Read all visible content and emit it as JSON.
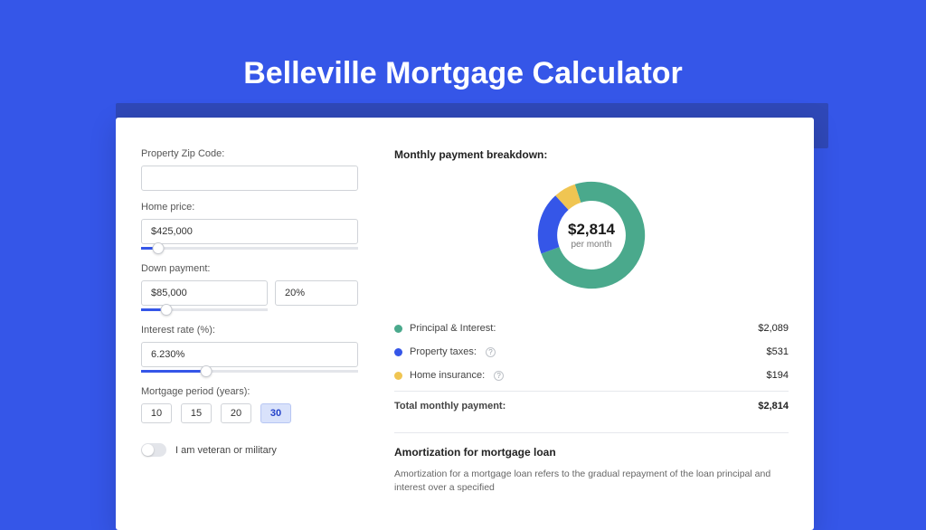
{
  "title": "Belleville Mortgage Calculator",
  "colors": {
    "principal": "#4aa98c",
    "taxes": "#3556e8",
    "insurance": "#f0c552"
  },
  "form": {
    "zip_label": "Property Zip Code:",
    "zip_value": "",
    "home_price_label": "Home price:",
    "home_price_value": "$425,000",
    "home_price_slider_pct": 8,
    "down_payment_label": "Down payment:",
    "down_payment_value": "$85,000",
    "down_payment_pct_value": "20%",
    "down_payment_slider_pct": 20,
    "interest_rate_label": "Interest rate (%):",
    "interest_rate_value": "6.230%",
    "interest_rate_slider_pct": 30,
    "period_label": "Mortgage period (years):",
    "periods": [
      "10",
      "15",
      "20",
      "30"
    ],
    "period_selected": "30",
    "veteran_label": "I am veteran or military",
    "veteran_on": false
  },
  "breakdown": {
    "title": "Monthly payment breakdown:",
    "donut_amount": "$2,814",
    "donut_sub": "per month",
    "items": [
      {
        "label": "Principal & Interest:",
        "value": "$2,089",
        "color": "#4aa98c",
        "info": false
      },
      {
        "label": "Property taxes:",
        "value": "$531",
        "color": "#3556e8",
        "info": true
      },
      {
        "label": "Home insurance:",
        "value": "$194",
        "color": "#f0c552",
        "info": true
      }
    ],
    "total_label": "Total monthly payment:",
    "total_value": "$2,814"
  },
  "chart_data": {
    "type": "pie",
    "title": "Monthly payment breakdown",
    "series": [
      {
        "name": "Principal & Interest",
        "value": 2089,
        "color": "#4aa98c"
      },
      {
        "name": "Property taxes",
        "value": 531,
        "color": "#3556e8"
      },
      {
        "name": "Home insurance",
        "value": 194,
        "color": "#f0c552"
      }
    ],
    "total": 2814,
    "center_label": "$2,814 per month"
  },
  "amortization": {
    "title": "Amortization for mortgage loan",
    "text": "Amortization for a mortgage loan refers to the gradual repayment of the loan principal and interest over a specified"
  }
}
